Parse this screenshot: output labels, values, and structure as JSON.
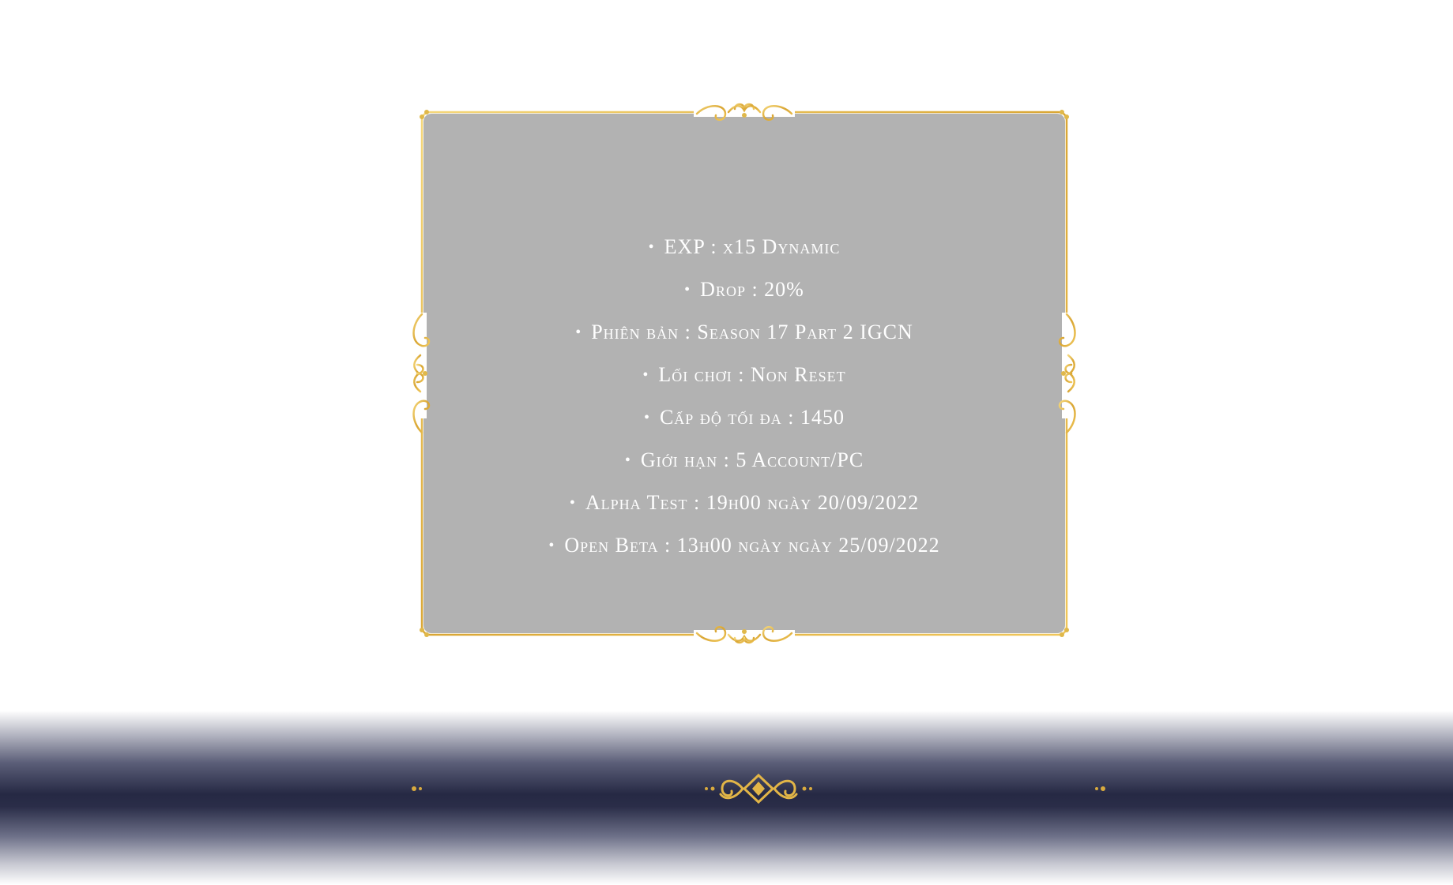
{
  "colors": {
    "panel_background": "#b2b2b2",
    "frame_gold": "#e0b84a",
    "text": "#ffffff",
    "footer_band": "#262944"
  },
  "info": {
    "bullet": "•",
    "items": [
      {
        "label": "EXP : x15 Dynamic"
      },
      {
        "label": "Drop : 20%"
      },
      {
        "label": "Phiên bản : Season 17 Part 2 IGCN"
      },
      {
        "label": "Lối chơi : Non Reset"
      },
      {
        "label": "Cấp độ tối đa : 1450"
      },
      {
        "label": "Giới hạn : 5 Account/PC"
      },
      {
        "label": "Alpha Test : 19h00 ngày 20/09/2022"
      },
      {
        "label": "Open Beta : 13h00 ngày ngày 25/09/2022"
      }
    ]
  },
  "icons": {
    "frame_ornament_top": "flourish-ornament-icon",
    "frame_ornament_bottom": "flourish-ornament-icon",
    "frame_ornament_left": "flourish-ornament-icon",
    "frame_ornament_right": "flourish-ornament-icon",
    "footer_divider": "ornamental-divider-icon"
  }
}
